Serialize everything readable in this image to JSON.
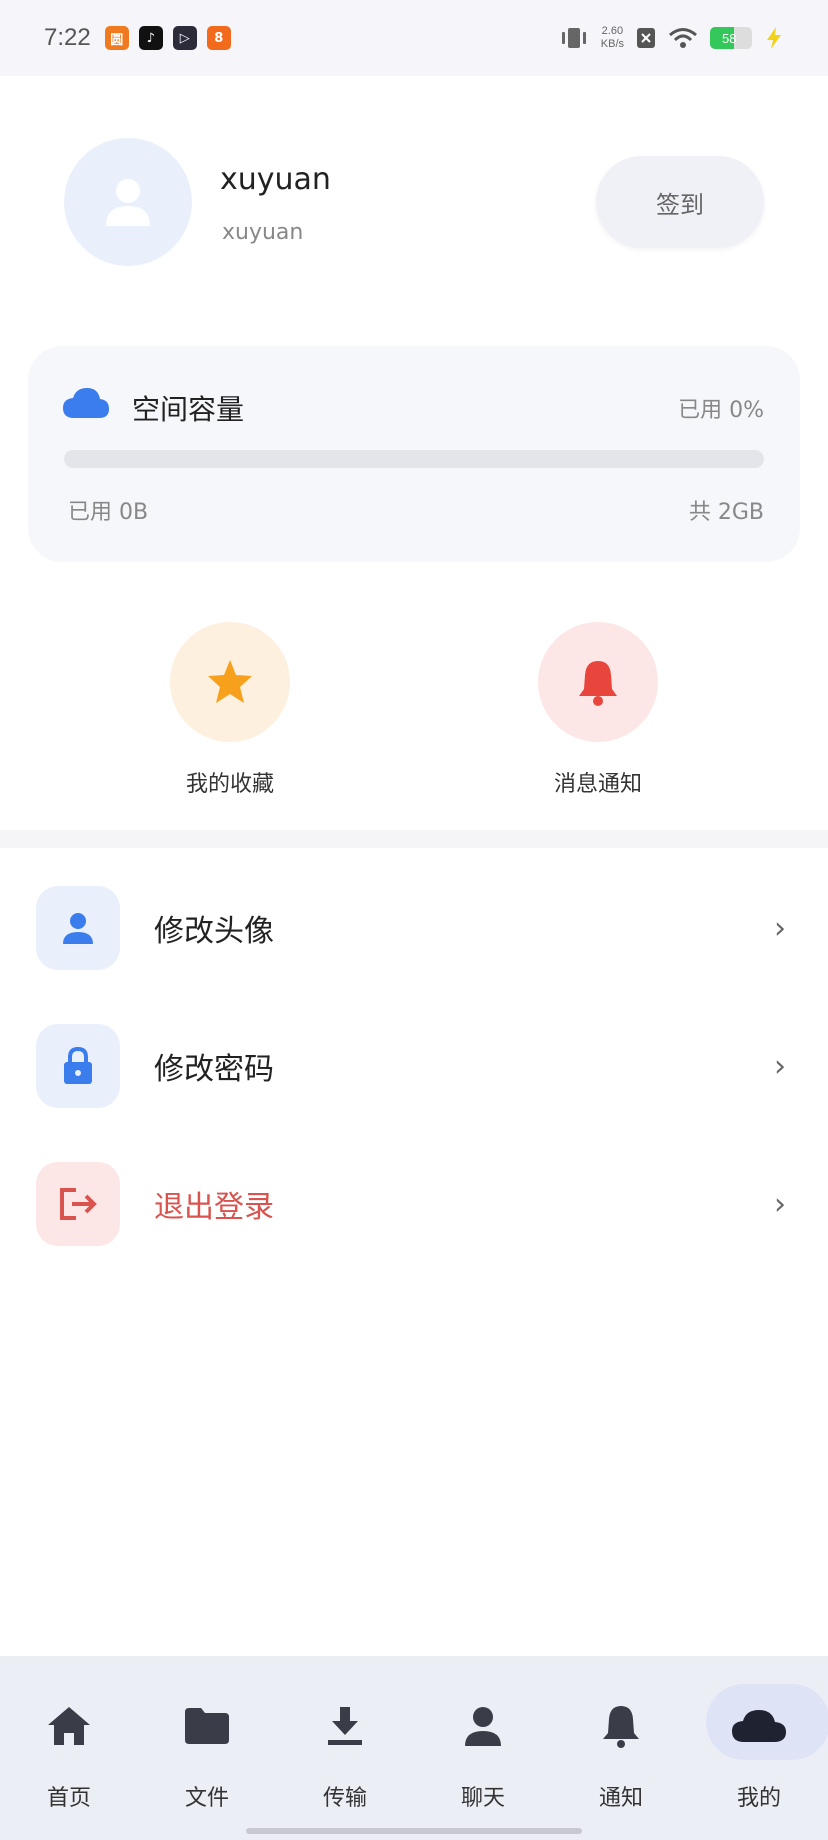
{
  "status_bar": {
    "time": "7:22",
    "net_speed_value": "2.60",
    "net_speed_unit": "KB/s",
    "battery_level": "58",
    "battery_fraction": 0.58,
    "apps": [
      {
        "icon": "app-icon-1",
        "glyph": "圆",
        "color": "#f07a1f"
      },
      {
        "icon": "music-icon",
        "glyph": "♪",
        "color": "#111111"
      },
      {
        "icon": "play-icon",
        "glyph": "▷",
        "color": "#2b2b3a"
      },
      {
        "icon": "app-icon-4",
        "glyph": "8",
        "color": "#f26b1d"
      }
    ]
  },
  "profile": {
    "name": "xuyuan",
    "id": "xuyuan",
    "checkin_label": "签到"
  },
  "storage": {
    "title": "空间容量",
    "used_percent_label": "已用 0%",
    "used_fraction": 0,
    "used_label": "已用 0B",
    "total_label": "共 2GB"
  },
  "quick_actions": [
    {
      "label": "我的收藏",
      "icon": "star-icon"
    },
    {
      "label": "消息通知",
      "icon": "bell-icon"
    }
  ],
  "menu": [
    {
      "label": "修改头像",
      "icon": "user-icon"
    },
    {
      "label": "修改密码",
      "icon": "lock-icon"
    },
    {
      "label": "退出登录",
      "icon": "logout-icon"
    }
  ],
  "bottom_nav": [
    {
      "label": "首页",
      "icon": "home-icon"
    },
    {
      "label": "文件",
      "icon": "folder-icon"
    },
    {
      "label": "传输",
      "icon": "download-icon"
    },
    {
      "label": "聊天",
      "icon": "person-icon"
    },
    {
      "label": "通知",
      "icon": "bell-icon"
    },
    {
      "label": "我的",
      "icon": "cloud-icon",
      "active": true
    }
  ],
  "colors": {
    "accent": "#3b7ded",
    "star": "#f7a01c",
    "bell": "#e8453c",
    "danger": "#d9534f",
    "nav_icon": "#3a3d47"
  }
}
